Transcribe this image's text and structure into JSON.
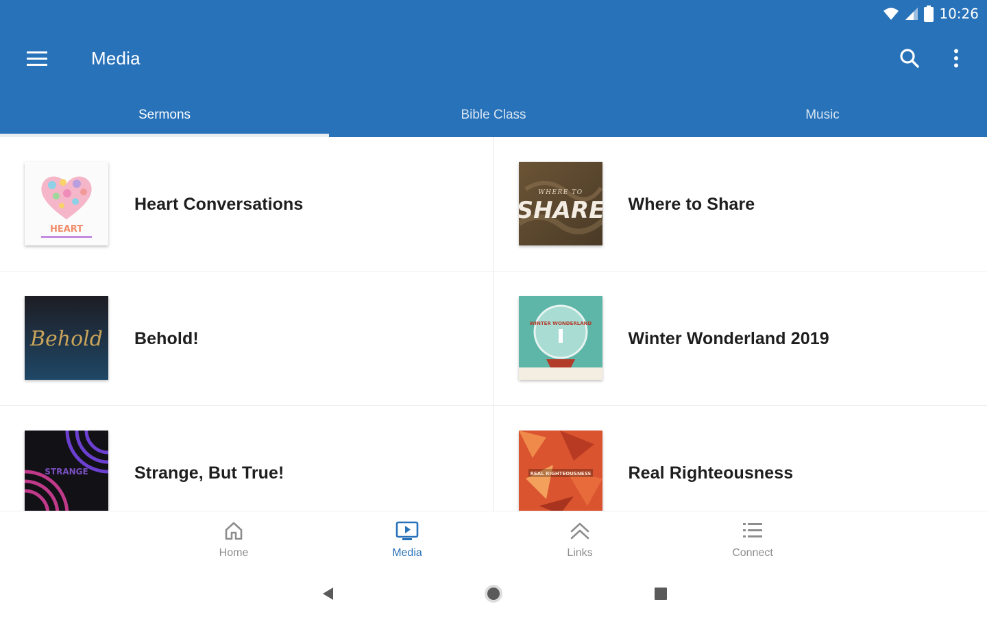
{
  "status_bar": {
    "time": "10:26"
  },
  "app_bar": {
    "title": "Media"
  },
  "tabs": [
    {
      "label": "Sermons",
      "active": true
    },
    {
      "label": "Bible Class",
      "active": false
    },
    {
      "label": "Music",
      "active": false
    }
  ],
  "items": [
    {
      "title": "Heart Conversations",
      "thumb_text": "HEART"
    },
    {
      "title": "Where to Share",
      "thumb_text": "SHARE",
      "thumb_subtext": "WHERE TO"
    },
    {
      "title": "Behold!",
      "thumb_text": "Behold"
    },
    {
      "title": "Winter Wonderland 2019",
      "thumb_text": "WINTER WONDERLAND"
    },
    {
      "title": "Strange, But True!",
      "thumb_text": "STRANGE"
    },
    {
      "title": "Real Righteousness",
      "thumb_text": "REAL RIGHTEOUSNESS"
    }
  ],
  "bottom_nav": [
    {
      "label": "Home",
      "icon": "home-icon",
      "active": false
    },
    {
      "label": "Media",
      "icon": "media-icon",
      "active": true
    },
    {
      "label": "Links",
      "icon": "links-icon",
      "active": false
    },
    {
      "label": "Connect",
      "icon": "list-icon",
      "active": false
    }
  ],
  "colors": {
    "primary": "#2872b9",
    "inactive_nav": "#8d8d8d"
  }
}
